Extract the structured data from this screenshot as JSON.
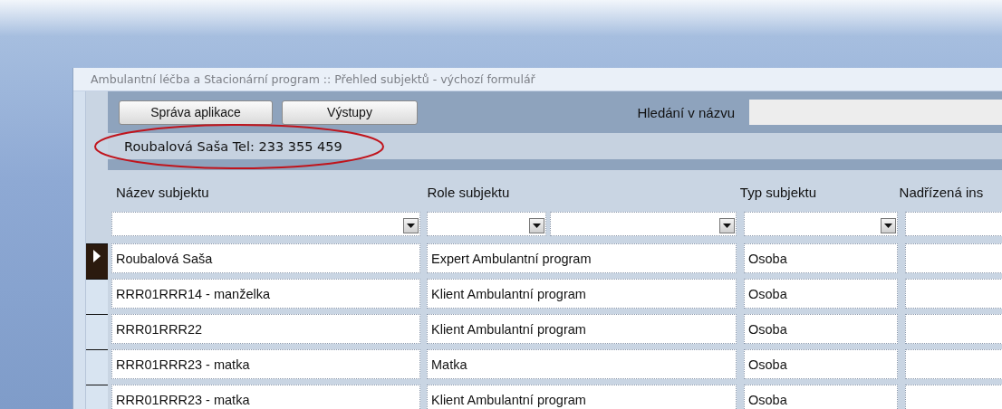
{
  "window": {
    "title": "Ambulantní léčba a Stacionární program :: Přehled subjektů - výchozí formulář"
  },
  "toolbar": {
    "buttons": [
      "Správa aplikace",
      "Výstupy"
    ],
    "search": {
      "label": "Hledání v názvu"
    }
  },
  "info_bar": {
    "text": "Roubalová Saša Tel: 233 355 459",
    "annotated": true
  },
  "table": {
    "columns": [
      "Název subjektu",
      "Role subjektu",
      "Typ subjektu",
      "Nadřízená ins"
    ],
    "filters": [
      {
        "kind": "dropdown"
      },
      {
        "kind": "dropdown"
      },
      {
        "kind": "dropdown"
      },
      {
        "kind": "dropdown"
      },
      {
        "kind": "text"
      }
    ],
    "rows": [
      {
        "selected": true,
        "cells": [
          "Roubalová Saša",
          "Expert Ambulantní program",
          "Osoba"
        ]
      },
      {
        "selected": false,
        "cells": [
          "RRR01RRR14 - manželka",
          "Klient Ambulantní program",
          "Osoba"
        ]
      },
      {
        "selected": false,
        "cells": [
          "RRR01RRR22",
          "Klient Ambulantní program",
          "Osoba"
        ]
      },
      {
        "selected": false,
        "cells": [
          "RRR01RRR23 - matka",
          "Matka",
          "Osoba"
        ]
      },
      {
        "selected": false,
        "cells": [
          "RRR01RRR23 - matka",
          "Klient Ambulantní program",
          "Osoba"
        ]
      }
    ]
  }
}
